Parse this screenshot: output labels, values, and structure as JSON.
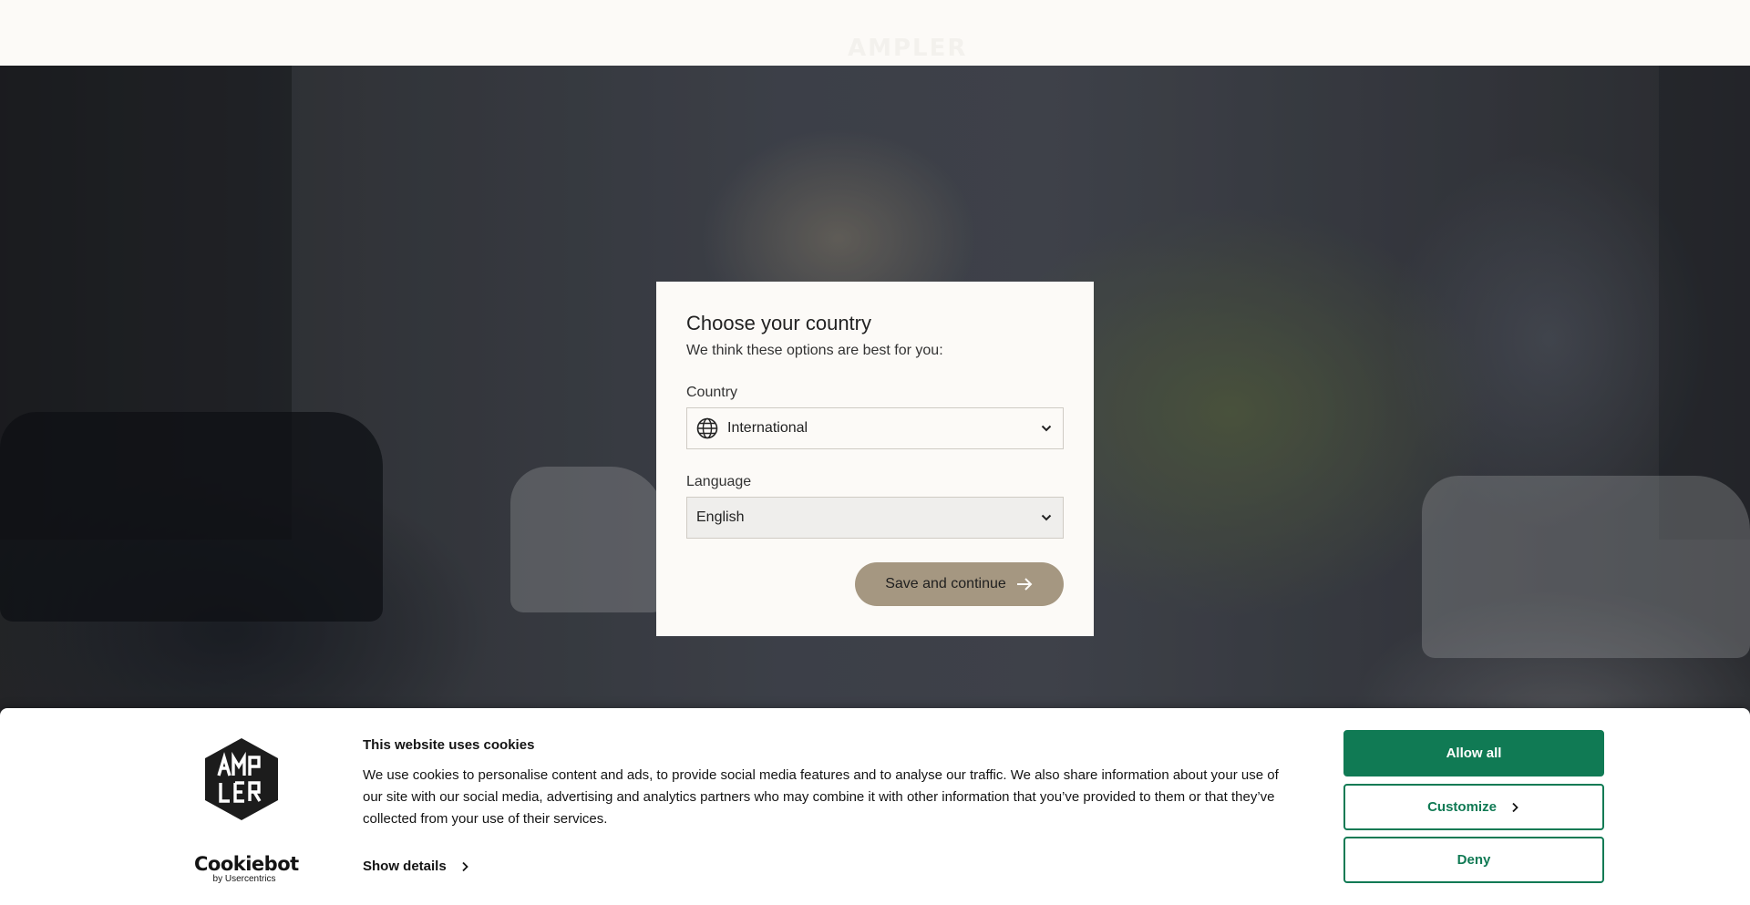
{
  "header": {
    "logo_text": "AMPLER"
  },
  "country_modal": {
    "title": "Choose your country",
    "subtitle": "We think these options are best for you:",
    "country_label": "Country",
    "country_value": "International",
    "language_label": "Language",
    "language_value": "English",
    "save_label": "Save and continue"
  },
  "cookie_banner": {
    "title": "This website uses cookies",
    "body": "We use cookies to personalise content and ads, to provide social media features and to analyse our traffic. We also share information about your use of our site with our social media, advertising and analytics partners who may combine it with other information that you’ve provided to them or that they’ve collected from your use of their services.",
    "show_details_label": "Show details",
    "provider_name": "Cookiebot",
    "provider_by": "by Usercentrics",
    "allow_all_label": "Allow all",
    "customize_label": "Customize",
    "deny_label": "Deny",
    "accent_color": "#107a54"
  },
  "colors": {
    "header_bg": "#fcfaf7",
    "modal_bg": "#fcfaf7",
    "save_button_bg": "#a59781"
  }
}
